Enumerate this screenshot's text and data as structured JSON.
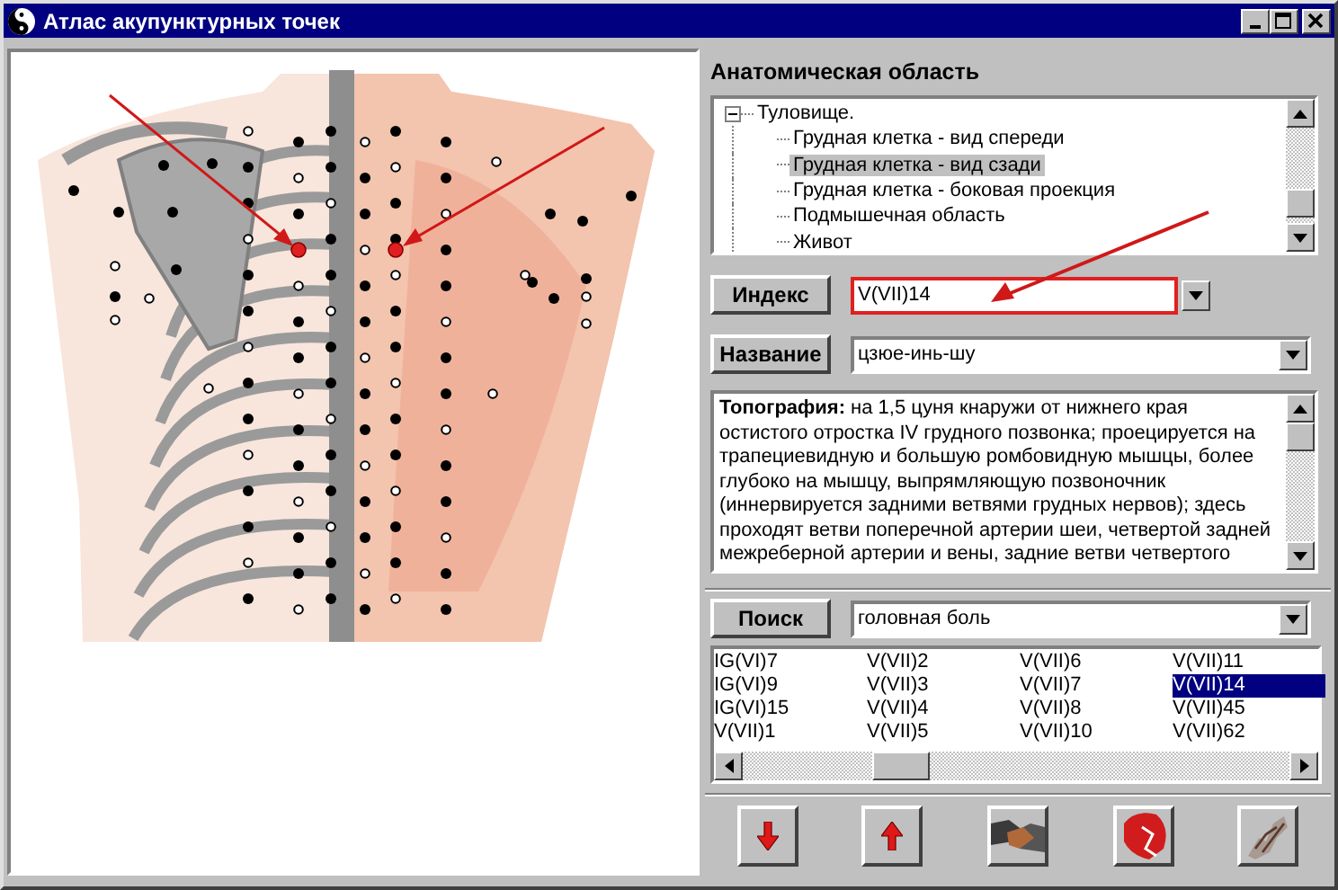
{
  "window": {
    "title": "Атлас акупунктурных точек"
  },
  "anatomy": {
    "heading": "Анатомическая область",
    "tree": [
      {
        "label": "Туловище.",
        "expanded": true,
        "selected": false,
        "children": [
          {
            "label": "Грудная клетка - вид спереди",
            "selected": false
          },
          {
            "label": "Грудная клетка - вид сзади",
            "selected": true
          },
          {
            "label": "Грудная клетка - боковая проекция",
            "selected": false
          },
          {
            "label": "Подмышечная область",
            "selected": false
          },
          {
            "label": "Живот",
            "selected": false
          }
        ]
      }
    ]
  },
  "index": {
    "button": "Индекс",
    "value": "V(VII)14",
    "highlighted": true
  },
  "name": {
    "button": "Название",
    "value": "цзюе-инь-шу"
  },
  "topography": {
    "text": "**Топография:** на 1,5 цуня кнаружи от нижнего края остистого отростка IV грудного позвонка; проецируется на трапециевидную и большую ромбовидную мышцы, более глубоко на мышцу, выпрямляющую позвоночник (иннервируется задними ветвями грудных нервов); здесь проходят ветви поперечной артерии шеи, четвертой задней межреберной артерии и вены, задние ветви четвертого"
  },
  "search": {
    "button": "Поиск",
    "value": "головная боль",
    "results": [
      {
        "label": "IG(VI)7",
        "selected": false
      },
      {
        "label": "IG(VI)9",
        "selected": false
      },
      {
        "label": "IG(VI)15",
        "selected": false
      },
      {
        "label": "V(VII)1",
        "selected": false
      },
      {
        "label": "V(VII)2",
        "selected": false
      },
      {
        "label": "V(VII)3",
        "selected": false
      },
      {
        "label": "V(VII)4",
        "selected": false
      },
      {
        "label": "V(VII)5",
        "selected": false
      },
      {
        "label": "V(VII)6",
        "selected": false
      },
      {
        "label": "V(VII)7",
        "selected": false
      },
      {
        "label": "V(VII)8",
        "selected": false
      },
      {
        "label": "V(VII)10",
        "selected": false
      },
      {
        "label": "V(VII)11",
        "selected": false
      },
      {
        "label": "V(VII)14",
        "selected": true
      },
      {
        "label": "V(VII)45",
        "selected": false
      },
      {
        "label": "V(VII)62",
        "selected": false
      }
    ]
  },
  "toolbar": [
    {
      "kind": "down"
    },
    {
      "kind": "up"
    },
    {
      "kind": "handshake"
    },
    {
      "kind": "figure"
    },
    {
      "kind": "bundle"
    }
  ]
}
